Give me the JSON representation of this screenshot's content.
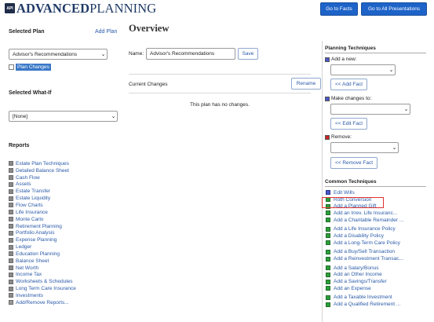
{
  "header": {
    "logo_badge": "API",
    "logo_bold": "ADVANCED",
    "logo_light": "PLANNING",
    "go_to_facts": "Go to Facts",
    "go_to_all_presentations": "Go to All Presentations"
  },
  "left": {
    "selected_plan_title": "Selected Plan",
    "add_plan": "Add Plan",
    "plan_select_value": "Advisor's Recommendations",
    "plan_changes_label": "Plan Changes",
    "selected_whatif_title": "Selected What-If",
    "whatif_select_value": "[None]",
    "reports_title": "Reports",
    "reports": [
      "Estate Plan Techniques",
      "Detailed Balance Sheet",
      "Cash Flow",
      "Assets",
      "Estate Transfer",
      "Estate Liquidity",
      "Flow Charts",
      "Life Insurance",
      "Monte Carlo",
      "Retirement Planning",
      "Portfolio Analysis",
      "Expense Planning",
      "Ledger",
      "Education Planning",
      "Balance Sheet",
      "Net Worth",
      "Income Tax",
      "Worksheets & Schedules",
      "Long Term Care Insurance",
      "Investments"
    ],
    "add_remove_reports": "Add/Remove Reports..."
  },
  "main": {
    "title": "Overview",
    "name_label": "Name:",
    "name_value": "Advisor's Recommendations",
    "save_label": "Save",
    "current_changes_title": "Current Changes",
    "rename_label": "Rename",
    "no_changes_text": "This plan has no changes."
  },
  "planning": {
    "title": "Planning Techniques",
    "add_new_label": "Add a new:",
    "add_fact_button": "<< Add Fact",
    "make_changes_label": "Make changes to:",
    "edit_fact_button": "<< Edit Fact",
    "remove_label": "Remove:",
    "remove_fact_button": "<< Remove Fact"
  },
  "common": {
    "title": "Common Techniques",
    "items": [
      "Edit Wills",
      "Roth Conversion",
      "Add a Planned Gift",
      "Add an Irrev. Life Insuranc...",
      "Add a Charitable Remainder ...",
      "Add a Life Insurance Policy",
      "Add a Disability Policy",
      "Add a Long-Term Care Policy",
      "Add a Buy/Sell Transaction",
      "Add a Reinvestment Transac...",
      "Add a Salary/Bonus",
      "Add an Other Income",
      "Add a Savings/Transfer",
      "Add an Expense",
      "Add a Taxable Investment",
      "Add a Qualified Retirement ..."
    ]
  },
  "colors": {
    "primary_button": "#1e63c8",
    "link": "#2a5aa8",
    "highlight_border": "#e03030"
  }
}
